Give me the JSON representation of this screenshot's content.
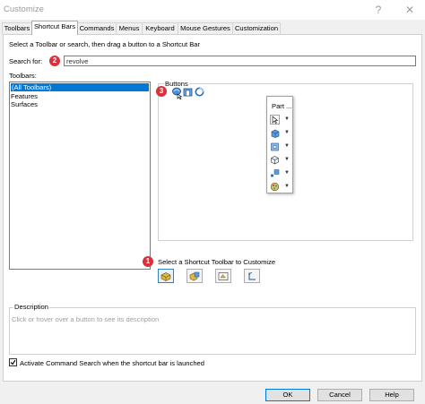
{
  "window": {
    "title": "Customize",
    "help_glyph": "?",
    "close_glyph": "✕"
  },
  "tabs": [
    {
      "label": "Toolbars",
      "active": false
    },
    {
      "label": "Shortcut Bars",
      "active": true
    },
    {
      "label": "Commands",
      "active": false
    },
    {
      "label": "Menus",
      "active": false
    },
    {
      "label": "Keyboard",
      "active": false
    },
    {
      "label": "Mouse Gestures",
      "active": false
    },
    {
      "label": "Customization",
      "active": false
    }
  ],
  "instruction": "Select a Toolbar or search, then drag a button to a Shortcut Bar",
  "search": {
    "label": "Search for:",
    "value": "revolve"
  },
  "callouts": [
    "1",
    "2",
    "3"
  ],
  "toolbars_list": {
    "label": "Toolbars:",
    "items": [
      "(All Toolbars)",
      "Features",
      "Surfaces"
    ],
    "selected": "(All Toolbars)"
  },
  "buttons_group": {
    "title": "Buttons",
    "icons": [
      "revolve-boss-icon",
      "revolve-cut-icon",
      "revolve-surface-icon"
    ]
  },
  "part_shortcut_bar": {
    "title": "Part ...",
    "rows": [
      "select-arrow-icon",
      "extrude-boss-icon",
      "extrude-cut-icon",
      "cube-view-icon",
      "sketch-point-icon",
      "appearance-icon"
    ]
  },
  "shortcut_toolbar": {
    "label": "Select a Shortcut Toolbar to Customize",
    "buttons": [
      "part-icon",
      "assembly-icon",
      "drawing-icon",
      "sketch-icon"
    ]
  },
  "description": {
    "title": "Description",
    "placeholder": "Click or hover over a button to see its description"
  },
  "activate_search": {
    "label": "Activate Command Search when the shortcut bar is launched",
    "checked": true
  },
  "dialog_buttons": {
    "ok": "OK",
    "cancel": "Cancel",
    "help": "Help"
  },
  "colors": {
    "accent": "#0078d7",
    "callout": "#d8323c"
  }
}
